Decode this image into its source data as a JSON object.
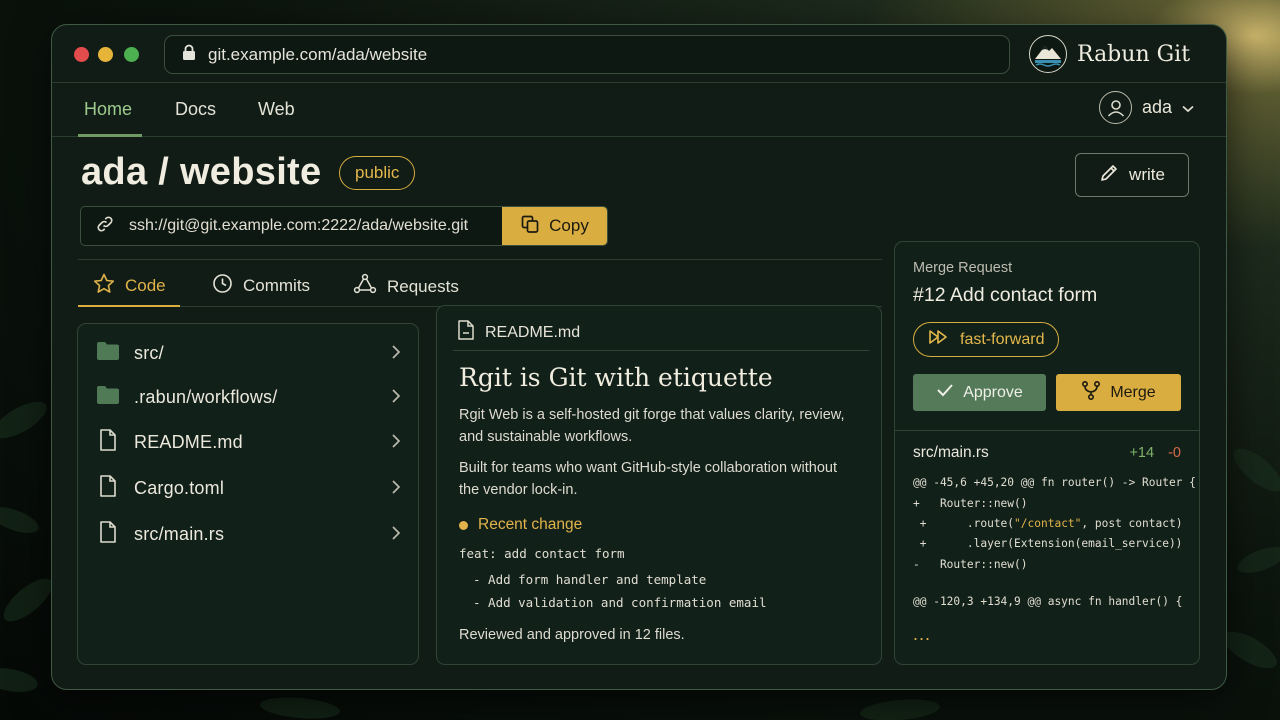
{
  "browser": {
    "url": "git.example.com/ada/website",
    "brand_name": "Rabun Git"
  },
  "nav": {
    "items": [
      {
        "label": "Home"
      },
      {
        "label": "Docs"
      },
      {
        "label": "Web"
      }
    ],
    "user": "ada"
  },
  "repo": {
    "title": "ada / website",
    "visibility": "public",
    "write_label": "write",
    "clone_url": "ssh://git@git.example.com:2222/ada/website.git",
    "copy_label": "Copy"
  },
  "tabs": [
    {
      "label": "Code"
    },
    {
      "label": "Commits"
    },
    {
      "label": "Requests"
    }
  ],
  "files": [
    {
      "name": "src/",
      "icon": "folder-icon"
    },
    {
      "name": ".rabun/workflows/",
      "icon": "folder-icon"
    },
    {
      "name": "README.md",
      "icon": "file-icon"
    },
    {
      "name": "Cargo.toml",
      "icon": "file-icon"
    },
    {
      "name": "src/main.rs",
      "icon": "file-icon"
    }
  ],
  "readme": {
    "filename": "README.md",
    "title": "Rgit is Git with etiquette",
    "para1": "Rgit Web is a self-hosted git forge that values clarity, review, and sustainable workflows.",
    "para2": "Built for teams who want GitHub-style collaboration without the vendor lock-in.",
    "recent_label": "Recent change",
    "commit_line": "feat: add contact form",
    "commit_bullets": [
      "- Add form handler and template",
      "- Add validation and confirmation email"
    ],
    "footer": "Reviewed and approved in 12 files."
  },
  "merge_request": {
    "label": "Merge Request",
    "title": "#12 Add contact form",
    "strategy": "fast-forward",
    "approve_label": "Approve",
    "merge_label": "Merge",
    "diff_file": "src/main.rs",
    "additions": "+14",
    "deletions": "-0",
    "diff_lines": {
      "hunk1": "@@ -45,6 +45,20 @@ fn router() -> Router {",
      "l1": "+   Router::new()",
      "l2_pre": " +      .route(",
      "l2_str": "\"/contact\"",
      "l2_post": ", post contact)",
      "l3": " +      .layer(Extension(email_service))",
      "l4": "-   Router::new()",
      "hunk2": "@@ -120,3 +134,9 @@ async fn handler() {",
      "ellipsis": "..."
    }
  },
  "colors": {
    "accent_gold": "#d9ad40",
    "accent_green": "#557a5a",
    "active_nav": "#9fcb8e"
  }
}
